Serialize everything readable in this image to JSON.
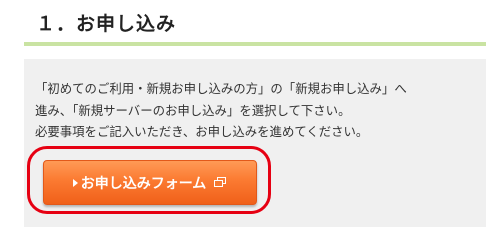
{
  "section": {
    "heading": "１．お申し込み"
  },
  "info": {
    "line1": "「初めてのご利用・新規お申し込みの方」の「新規お申し込み」へ",
    "line2": "進み、「新規サーバーのお申し込み」を選択して下さい。",
    "line3": "必要事項をご記入いただき、お申し込みを進めてください。"
  },
  "button": {
    "label": "お申し込みフォーム",
    "icons": [
      "arrow-right-icon",
      "new-window-icon"
    ]
  },
  "colors": {
    "heading_rule": "#c9e3a2",
    "box_background": "#f0f0f0",
    "button_orange": "#fb7a31",
    "highlight_red": "#e60012"
  }
}
